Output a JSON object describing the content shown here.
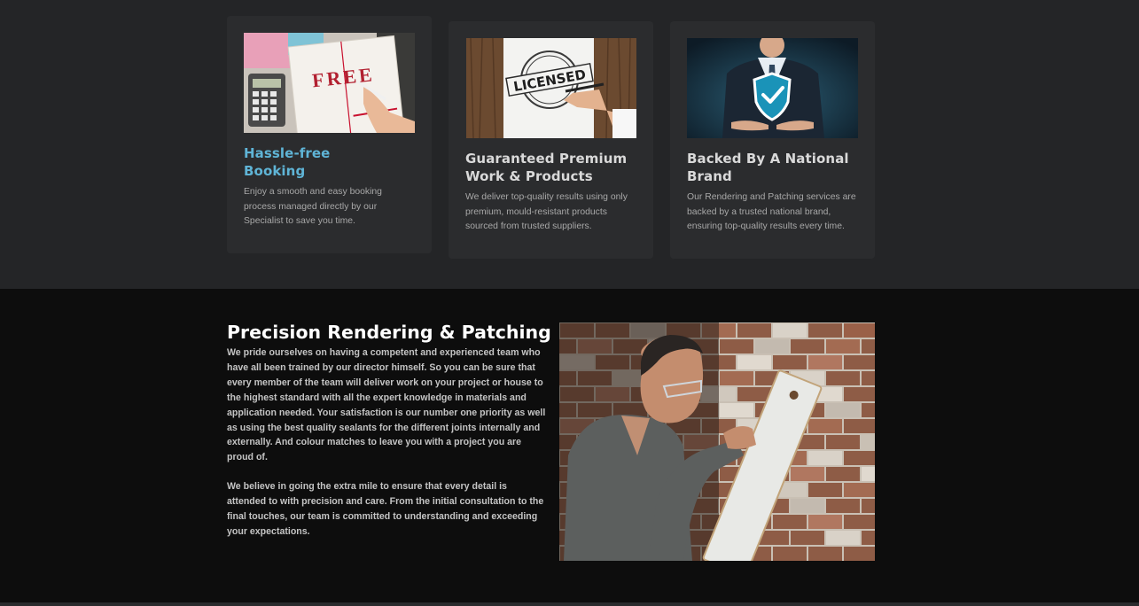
{
  "features": [
    {
      "title_line1": "Hassle-free",
      "title_line2": "Booking",
      "description": "Enjoy a smooth and easy booking process managed directly by our Specialist to save you time.",
      "image_label": "FREE",
      "accent": "#5fb4d6"
    },
    {
      "title_line1": "Guaranteed Premium",
      "title_line2": "Work & Products",
      "description": "We deliver top-quality results using only premium, mould-resistant products sourced from trusted suppliers.",
      "image_label": "LICENSED"
    },
    {
      "title_line1": "Backed By A National",
      "title_line2": "Brand",
      "description": "Our Rendering and Patching services are backed by a trusted national brand, ensuring top-quality results every time."
    }
  ],
  "precision": {
    "title": "Precision Rendering & Patching",
    "paragraph1": "We pride ourselves on having a competent and experienced team who have all been trained by our director himself. So you can be sure that every member of the team will deliver work on your project or house to the highest standard with all the expert knowledge in materials and application needed. Your satisfaction is our number one priority as well as using the best quality sealants for the different joints internally and externally. And colour matches to leave you with a project you are proud of.",
    "paragraph2": "We believe in going the extra mile to ensure that every detail is attended to with precision and care. From the initial consultation to the final touches, our team is committed to understanding and exceeding your expectations."
  },
  "icons": {
    "free-image": "notebook-calculator-photo",
    "licensed-image": "licensed-stamp-photo",
    "brand-image": "shield-check-icon",
    "worker-image": "worker-brick-wall-photo"
  }
}
